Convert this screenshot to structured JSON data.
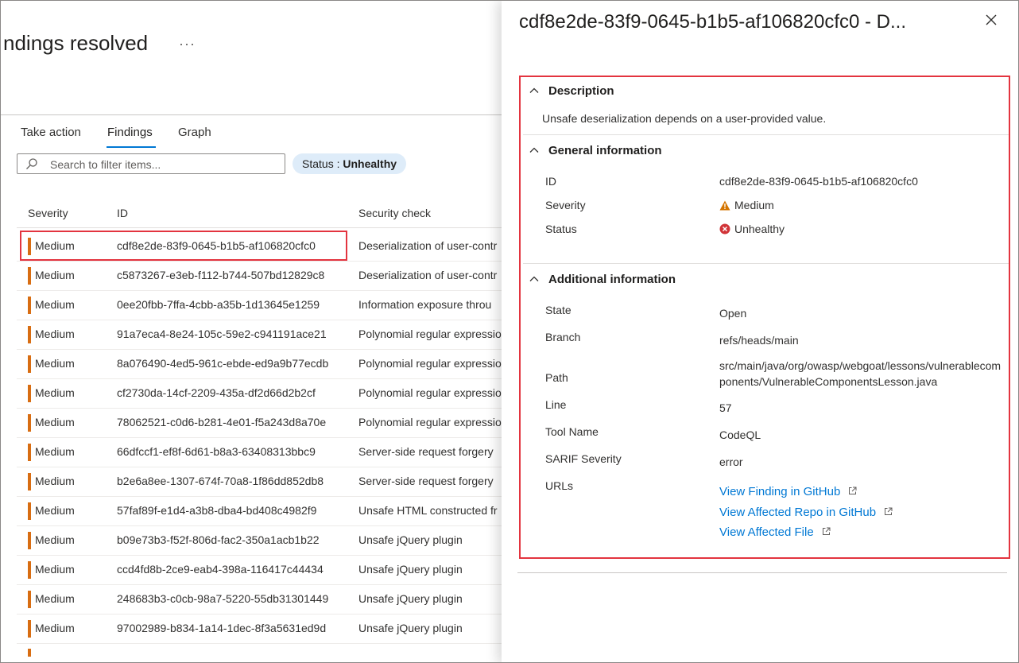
{
  "page": {
    "title": "ndings resolved",
    "more": "···"
  },
  "tabs": [
    {
      "label": "Take action"
    },
    {
      "label": "Findings",
      "active": true
    },
    {
      "label": "Graph"
    }
  ],
  "search": {
    "placeholder": "Search to filter items..."
  },
  "filter_pill": {
    "label": "Status : ",
    "value": "Unhealthy"
  },
  "table": {
    "columns": [
      "Severity",
      "ID",
      "Security check"
    ],
    "rows": [
      {
        "severity": "Medium",
        "id": "cdf8e2de-83f9-0645-b1b5-af106820cfc0",
        "check": "Deserialization of user-contr"
      },
      {
        "severity": "Medium",
        "id": "c5873267-e3eb-f112-b744-507bd12829c8",
        "check": "Deserialization of user-contr"
      },
      {
        "severity": "Medium",
        "id": "0ee20fbb-7ffa-4cbb-a35b-1d13645e1259",
        "check": "Information exposure throu"
      },
      {
        "severity": "Medium",
        "id": "91a7eca4-8e24-105c-59e2-c941191ace21",
        "check": "Polynomial regular expressio"
      },
      {
        "severity": "Medium",
        "id": "8a076490-4ed5-961c-ebde-ed9a9b77ecdb",
        "check": "Polynomial regular expressio"
      },
      {
        "severity": "Medium",
        "id": "cf2730da-14cf-2209-435a-df2d66d2b2cf",
        "check": "Polynomial regular expressio"
      },
      {
        "severity": "Medium",
        "id": "78062521-c0d6-b281-4e01-f5a243d8a70e",
        "check": "Polynomial regular expressio"
      },
      {
        "severity": "Medium",
        "id": "66dfccf1-ef8f-6d61-b8a3-63408313bbc9",
        "check": "Server-side request forgery"
      },
      {
        "severity": "Medium",
        "id": "b2e6a8ee-1307-674f-70a8-1f86dd852db8",
        "check": "Server-side request forgery"
      },
      {
        "severity": "Medium",
        "id": "57faf89f-e1d4-a3b8-dba4-bd408c4982f9",
        "check": "Unsafe HTML constructed fr"
      },
      {
        "severity": "Medium",
        "id": "b09e73b3-f52f-806d-fac2-350a1acb1b22",
        "check": "Unsafe jQuery plugin"
      },
      {
        "severity": "Medium",
        "id": "ccd4fd8b-2ce9-eab4-398a-116417c44434",
        "check": "Unsafe jQuery plugin"
      },
      {
        "severity": "Medium",
        "id": "248683b3-c0cb-98a7-5220-55db31301449",
        "check": "Unsafe jQuery plugin"
      },
      {
        "severity": "Medium",
        "id": "97002989-b834-1a14-1dec-8f3a5631ed9d",
        "check": "Unsafe jQuery plugin"
      }
    ]
  },
  "panel": {
    "title": "cdf8e2de-83f9-0645-b1b5-af106820cfc0 - D...",
    "description": {
      "heading": "Description",
      "text": "Unsafe deserialization depends on a user-provided value."
    },
    "general": {
      "heading": "General information",
      "id_label": "ID",
      "id_value": "cdf8e2de-83f9-0645-b1b5-af106820cfc0",
      "severity_label": "Severity",
      "severity_value": "Medium",
      "status_label": "Status",
      "status_value": "Unhealthy"
    },
    "additional": {
      "heading": "Additional information",
      "state_label": "State",
      "state_value": "Open",
      "branch_label": "Branch",
      "branch_value": "refs/heads/main",
      "path_label": "Path",
      "path_value": "src/main/java/org/owasp/webgoat/lessons/vulnerablecomponents/VulnerableComponentsLesson.java",
      "line_label": "Line",
      "line_value": "57",
      "tool_label": "Tool Name",
      "tool_value": "CodeQL",
      "sarif_label": "SARIF Severity",
      "sarif_value": "error",
      "urls_label": "URLs",
      "links": [
        {
          "label": "View Finding in GitHub"
        },
        {
          "label": "View Affected Repo in GitHub"
        },
        {
          "label": "View Affected File"
        }
      ]
    }
  },
  "colors": {
    "accent": "#0078d4",
    "severity_medium": "#d86d12",
    "highlight": "#e3343f",
    "warning": "#d47500",
    "error": "#d13438"
  }
}
